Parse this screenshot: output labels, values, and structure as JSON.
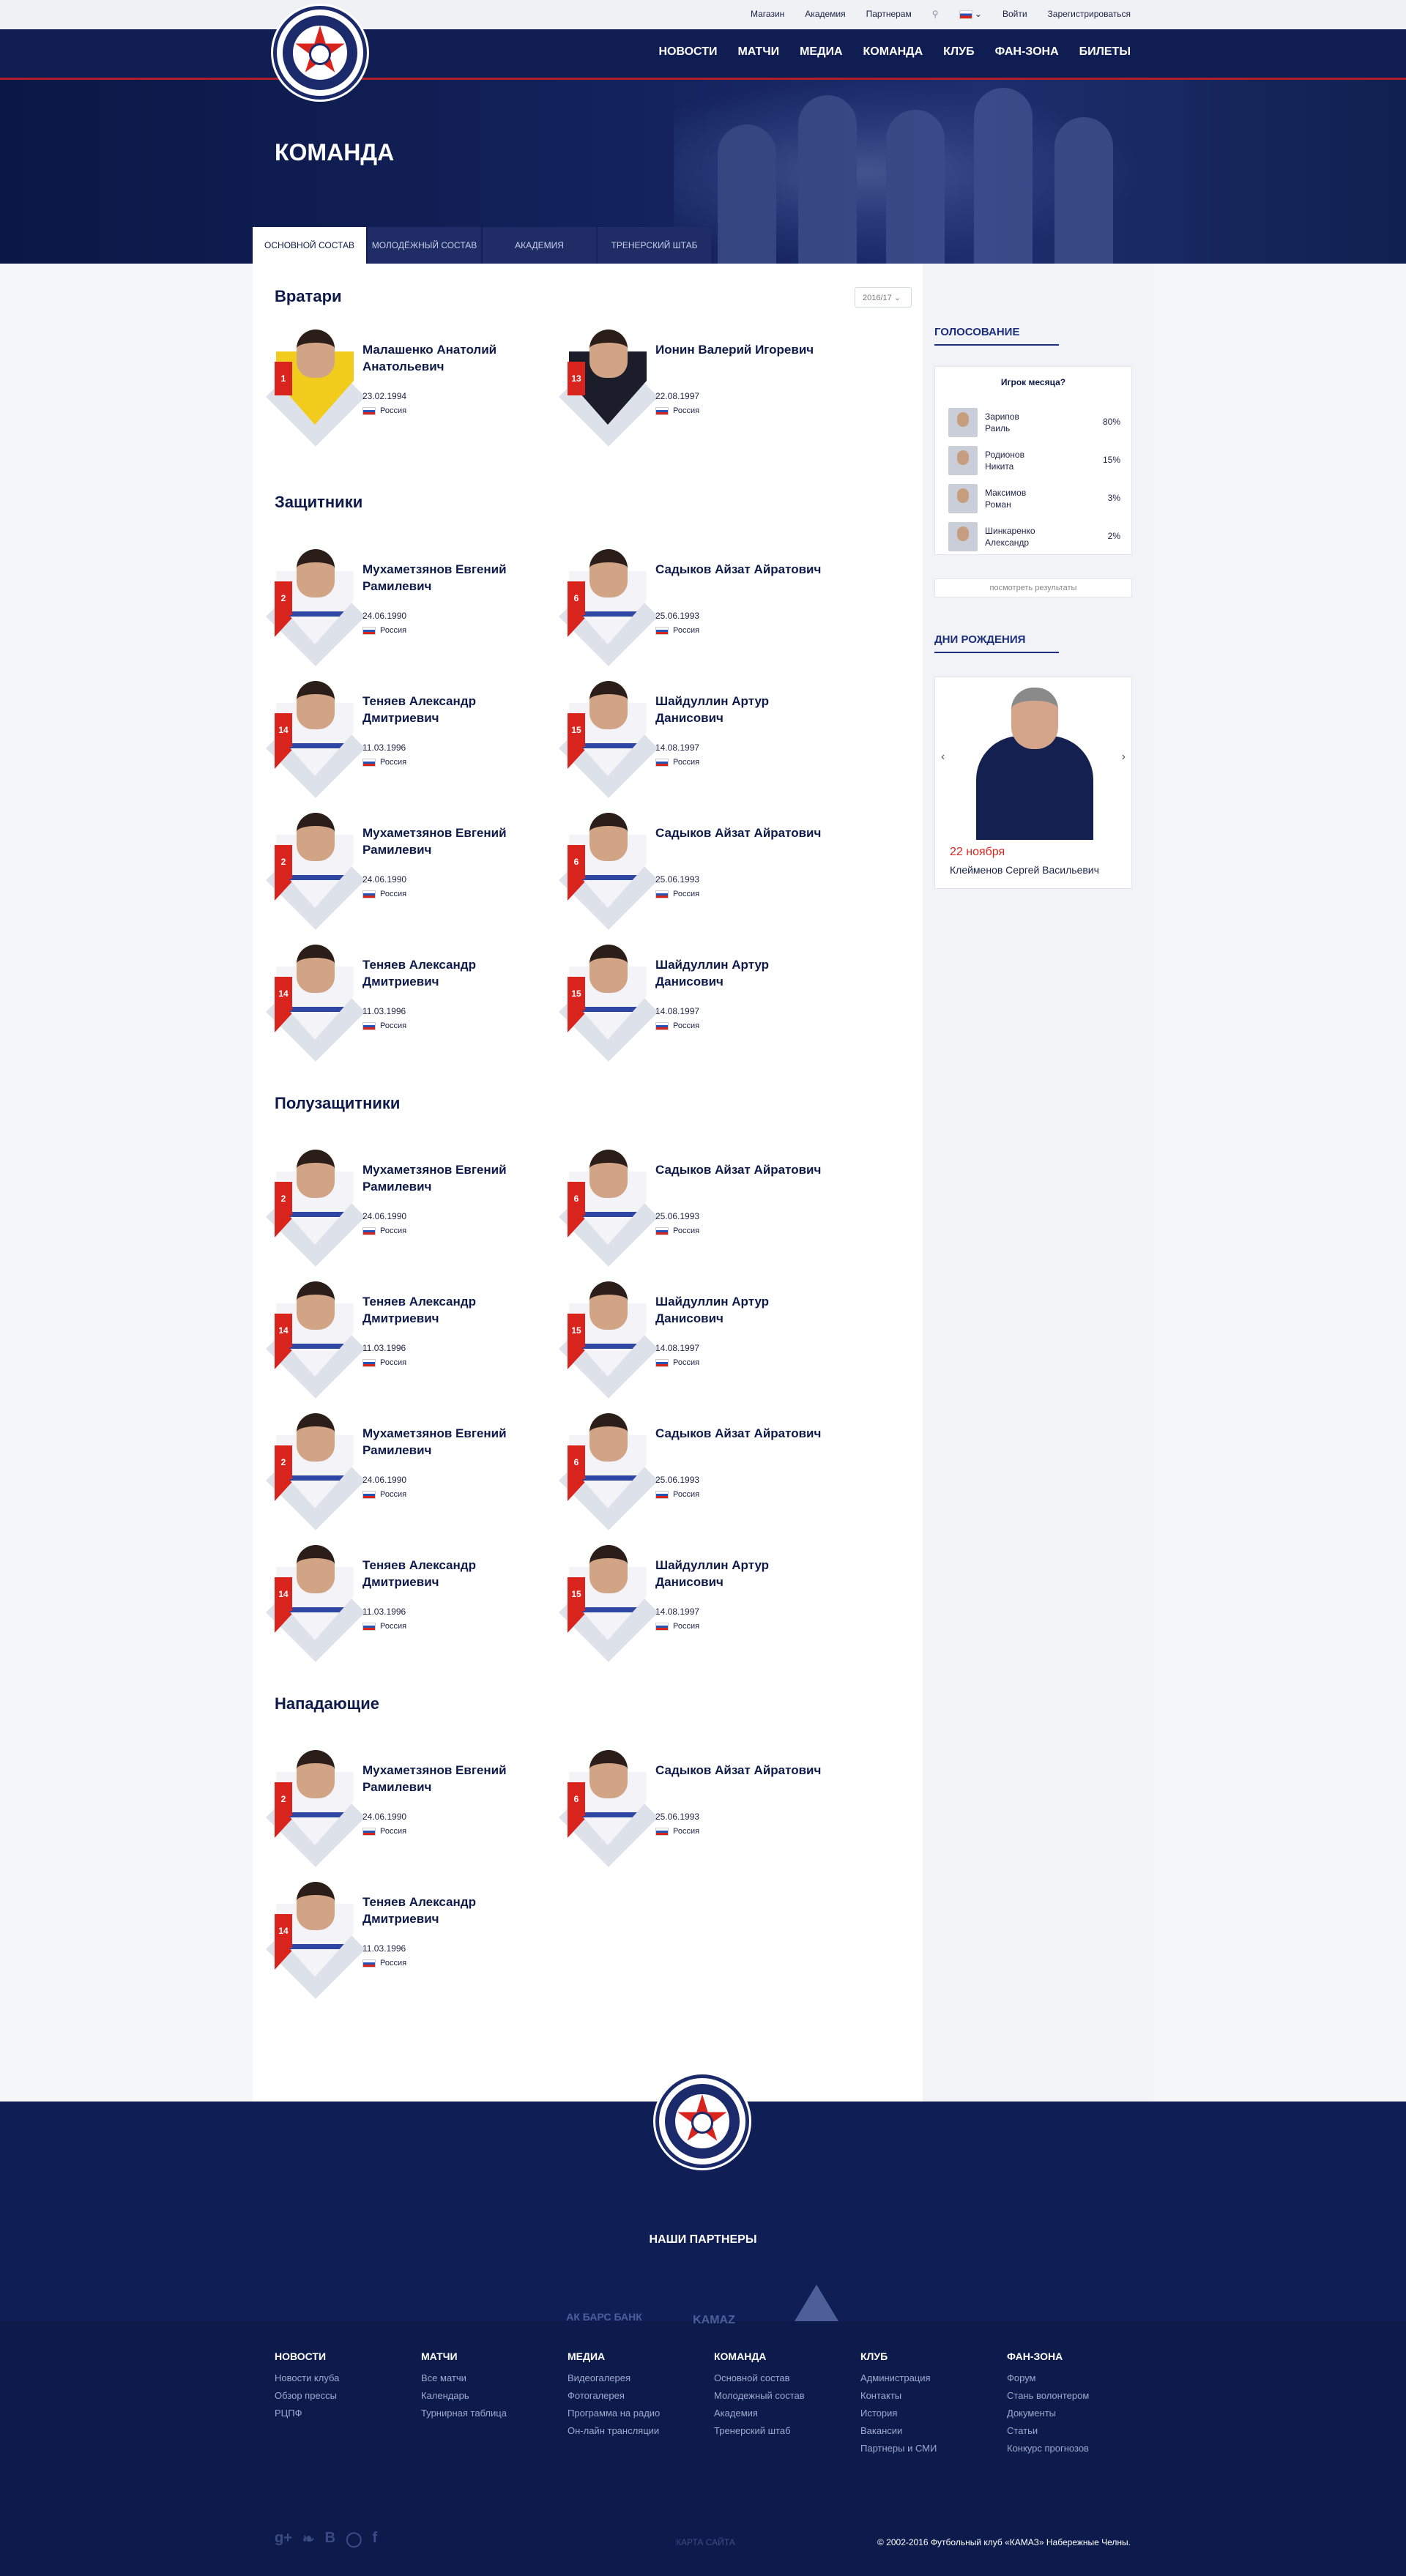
{
  "topbar": {
    "shop": "Магазин",
    "academy": "Академия",
    "partners": "Партнерам",
    "login": "Войти",
    "register": "Зарегистрироваться"
  },
  "nav": [
    "НОВОСТИ",
    "МАТЧИ",
    "МЕДИА",
    "КОМАНДА",
    "КЛУБ",
    "ФАН-ЗОНА",
    "БИЛЕТЫ"
  ],
  "page_title": "КОМАНДА",
  "tabs": [
    "ОСНОВНОЙ СОСТАВ",
    "МОЛОДЁЖНЫЙ СОСТАВ",
    "АКАДЕМИЯ",
    "ТРЕНЕРСКИЙ ШТАБ"
  ],
  "season": "2016/17",
  "sections": {
    "gk": "Вратари",
    "df": "Защитники",
    "mf": "Полузащитники",
    "fw": "Нападающие"
  },
  "players": {
    "gk1": {
      "num": "1",
      "name": "Малашенко Анатолий Анатольевич",
      "dob": "23.02.1994",
      "country": "Россия"
    },
    "gk2": {
      "num": "13",
      "name": "Ионин Валерий Игоревич",
      "dob": "22.08.1997",
      "country": "Россия"
    },
    "p2": {
      "num": "2",
      "name": "Мухаметзянов Евгений Рамилевич",
      "dob": "24.06.1990",
      "country": "Россия"
    },
    "p6": {
      "num": "6",
      "name": "Садыков Айзат Айратович",
      "dob": "25.06.1993",
      "country": "Россия"
    },
    "p14": {
      "num": "14",
      "name": "Теняев Александр Дмитриевич",
      "dob": "11.03.1996",
      "country": "Россия"
    },
    "p15": {
      "num": "15",
      "name": "Шайдуллин Артур Данисович",
      "dob": "14.08.1997",
      "country": "Россия"
    }
  },
  "sidebar": {
    "vote_title": "ГОЛОСОВАНИЕ",
    "poll_q": "Игрок месяца?",
    "poll": [
      {
        "name1": "Зарипов",
        "name2": "Раиль",
        "pct": "80%"
      },
      {
        "name1": "Родионов",
        "name2": "Никита",
        "pct": "15%"
      },
      {
        "name1": "Максимов",
        "name2": "Роман",
        "pct": "3%"
      },
      {
        "name1": "Шинкаренко",
        "name2": "Александр",
        "pct": "2%"
      }
    ],
    "poll_btn": "посмотреть результаты",
    "bday_title": "ДНИ РОЖДЕНИЯ",
    "bday_date": "22 ноября",
    "bday_name": "Клейменов Сергей Васильевич"
  },
  "footer": {
    "partners_title": "НАШИ ПАРТНЕРЫ",
    "partner1": "АК БАРС БАНК",
    "partner2": "KAMAZ",
    "cols": [
      {
        "h": "НОВОСТИ",
        "items": [
          "Новости клуба",
          "Обзор прессы",
          "РЦПФ"
        ]
      },
      {
        "h": "МАТЧИ",
        "items": [
          "Все матчи",
          "Календарь",
          "Турнирная таблица"
        ]
      },
      {
        "h": "МЕДИА",
        "items": [
          "Видеогалерея",
          "Фотогалерея",
          "Программа на радио",
          "Он-лайн трансляции"
        ]
      },
      {
        "h": "КОМАНДА",
        "items": [
          "Основной состав",
          "Молодежный состав",
          "Академия",
          "Тренерский штаб"
        ]
      },
      {
        "h": "КЛУБ",
        "items": [
          "Администрация",
          "Контакты",
          "История",
          "Вакансии",
          "Партнеры и СМИ"
        ]
      },
      {
        "h": "ФАН-ЗОНА",
        "items": [
          "Форум",
          "Стань волонтером",
          "Документы",
          "Статьи",
          "Конкурс прогнозов"
        ]
      }
    ],
    "sitemap": "КАРТА САЙТА",
    "copyright": "© 2002-2016 Футбольный клуб «КАМАЗ» Набережные Челны."
  }
}
